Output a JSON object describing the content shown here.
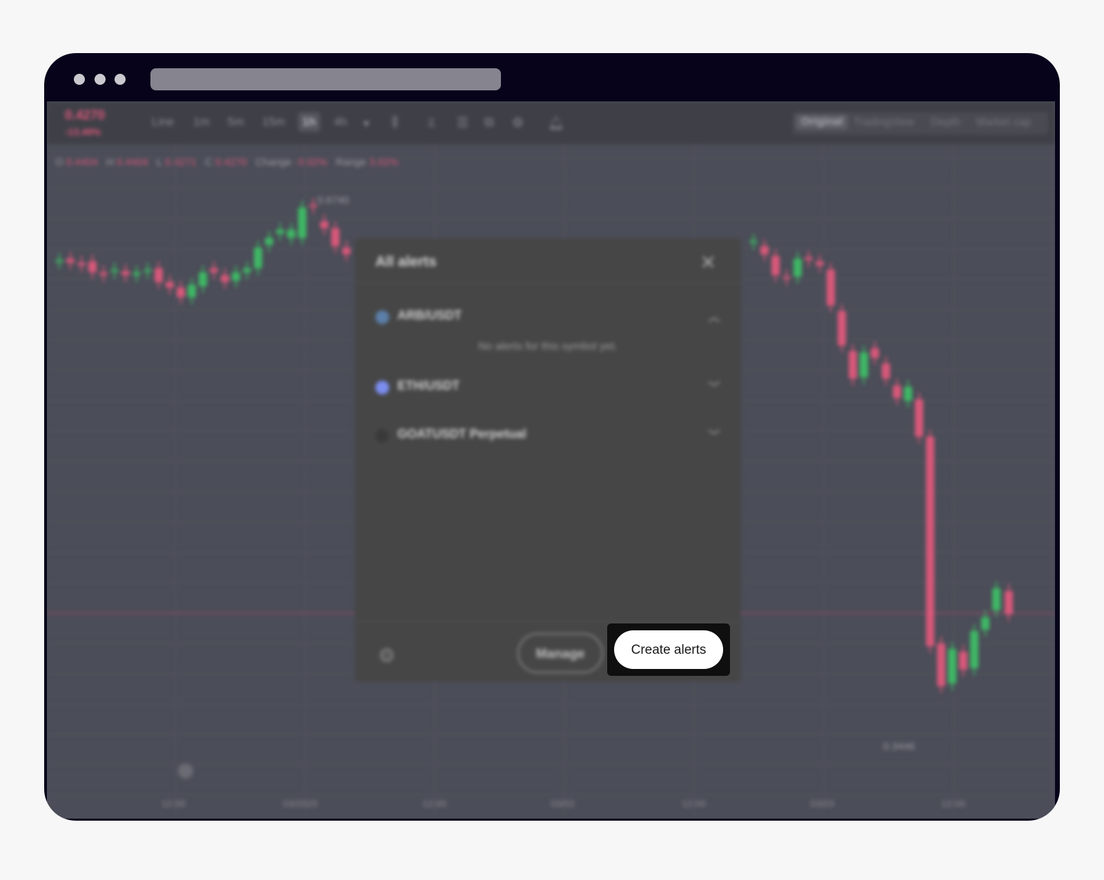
{
  "toolbar": {
    "price": "0.4270",
    "change_pct": "-13.49%",
    "intervals": [
      "Line",
      "1m",
      "5m",
      "15m",
      "1h",
      "4h"
    ],
    "active_interval": "1h",
    "views": [
      "Original",
      "TradingView",
      "Depth",
      "Market cap"
    ],
    "active_view": "Original"
  },
  "ohlc": {
    "o_label": "O",
    "o": "0.4404",
    "h_label": "H",
    "h": "0.4404",
    "l_label": "L",
    "l": "0.4271",
    "c_label": "C",
    "c": "0.4270",
    "change_label": "Change",
    "change": "-3.02%",
    "range_label": "Range",
    "range": "3.02%"
  },
  "chart_data": {
    "type": "candlestick",
    "high_label": "0.6740",
    "low_label": "0.3446",
    "x_ticks": [
      "12:00",
      "03/2025",
      "12:00",
      "03/02",
      "12:00",
      "03/03",
      "12:00"
    ]
  },
  "modal": {
    "title": "All alerts",
    "symbols": [
      {
        "name": "ARB/USDT",
        "expanded": true,
        "note": "No alerts for this symbol yet."
      },
      {
        "name": "ETH/USDT",
        "expanded": false
      },
      {
        "name": "GOATUSDT Perpetual",
        "expanded": false
      }
    ],
    "manage_label": "Manage",
    "create_label": "Create alerts"
  },
  "colors": {
    "up": "#3fb765",
    "down": "#d8587a",
    "frame": "#06031a",
    "modal_bg": "#464646"
  }
}
